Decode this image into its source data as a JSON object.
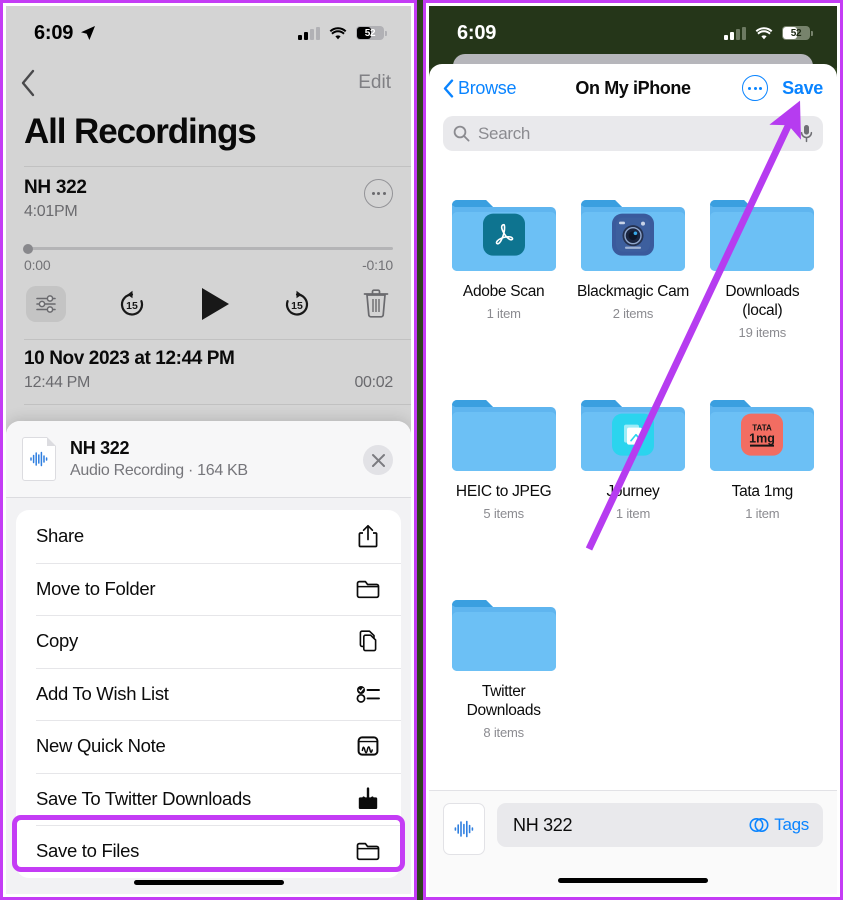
{
  "annotation": {
    "accent_color": "#c43cf5",
    "arrow": "purple-arrow-pointing-to-save"
  },
  "left_panel": {
    "status_bar": {
      "time": "6:09",
      "location_icon": "location-arrow-icon",
      "cellular": "signal-bars-icon",
      "wifi": "wifi-icon",
      "battery_percent": "52"
    },
    "nav": {
      "back_icon": "chevron-left-icon",
      "edit_label": "Edit"
    },
    "page_title": "All Recordings",
    "recording": {
      "name": "NH 322",
      "time": "4:01PM",
      "more_icon": "ellipsis-circle-icon",
      "elapsed": "0:00",
      "remaining": "-0:10",
      "controls": {
        "enhance": "audio-settings-icon",
        "rewind": "rewind-15-icon",
        "play": "play-icon",
        "forward": "forward-15-icon",
        "delete": "trash-icon"
      }
    },
    "second_row": {
      "title": "10 Nov 2023 at 12:44 PM",
      "time": "12:44 PM",
      "duration": "00:02"
    },
    "share_sheet": {
      "file": {
        "name": "NH 322",
        "subtitle": "Audio Recording · 164 KB",
        "thumb_icon": "audio-waveform-file-icon",
        "close_icon": "close-icon"
      },
      "menu_items": [
        {
          "label": "Share",
          "icon": "share-up-icon"
        },
        {
          "label": "Move to Folder",
          "icon": "folder-icon"
        },
        {
          "label": "Copy",
          "icon": "copy-icon"
        },
        {
          "label": "Add To Wish List",
          "icon": "checklist-icon"
        },
        {
          "label": "New Quick Note",
          "icon": "quick-note-icon"
        },
        {
          "label": "Save To Twitter Downloads",
          "icon": "download-filled-icon"
        },
        {
          "label": "Save to Files",
          "icon": "folder-icon",
          "highlighted": true
        }
      ]
    }
  },
  "right_panel": {
    "status_bar": {
      "time": "6:09",
      "cellular": "signal-bars-icon",
      "wifi": "wifi-icon",
      "battery_percent": "52"
    },
    "nav": {
      "back_icon": "chevron-left-icon",
      "back_label": "Browse",
      "title": "On My iPhone",
      "more_icon": "ellipsis-circle-icon",
      "save_label": "Save"
    },
    "search": {
      "placeholder": "Search",
      "icon": "search-icon",
      "mic_icon": "microphone-icon"
    },
    "folders": [
      {
        "name": "Adobe Scan",
        "count": "1 item",
        "badge": "adobe-acrobat-icon",
        "badge_color": "#0e7490"
      },
      {
        "name": "Blackmagic Cam",
        "count": "2 items",
        "badge": "blackmagic-cam-icon",
        "badge_color": "#3a5a9c"
      },
      {
        "name": "Downloads (local)",
        "count": "19 items",
        "badge": null,
        "badge_color": null
      },
      {
        "name": "HEIC to JPEG",
        "count": "5 items",
        "badge": null,
        "badge_color": null
      },
      {
        "name": "Journey",
        "count": "1 item",
        "badge": "journey-app-icon",
        "badge_color": "#22d3ee"
      },
      {
        "name": "Tata 1mg",
        "count": "1 item",
        "badge": "tata-1mg-icon",
        "badge_color": "#f26d62"
      },
      {
        "name": "Twitter Downloads",
        "count": "8 items",
        "badge": null,
        "badge_color": null
      }
    ],
    "bottom": {
      "thumb_icon": "audio-waveform-icon",
      "filename": "NH 322",
      "tags_label": "Tags",
      "tags_icon": "tags-circles-icon"
    }
  }
}
